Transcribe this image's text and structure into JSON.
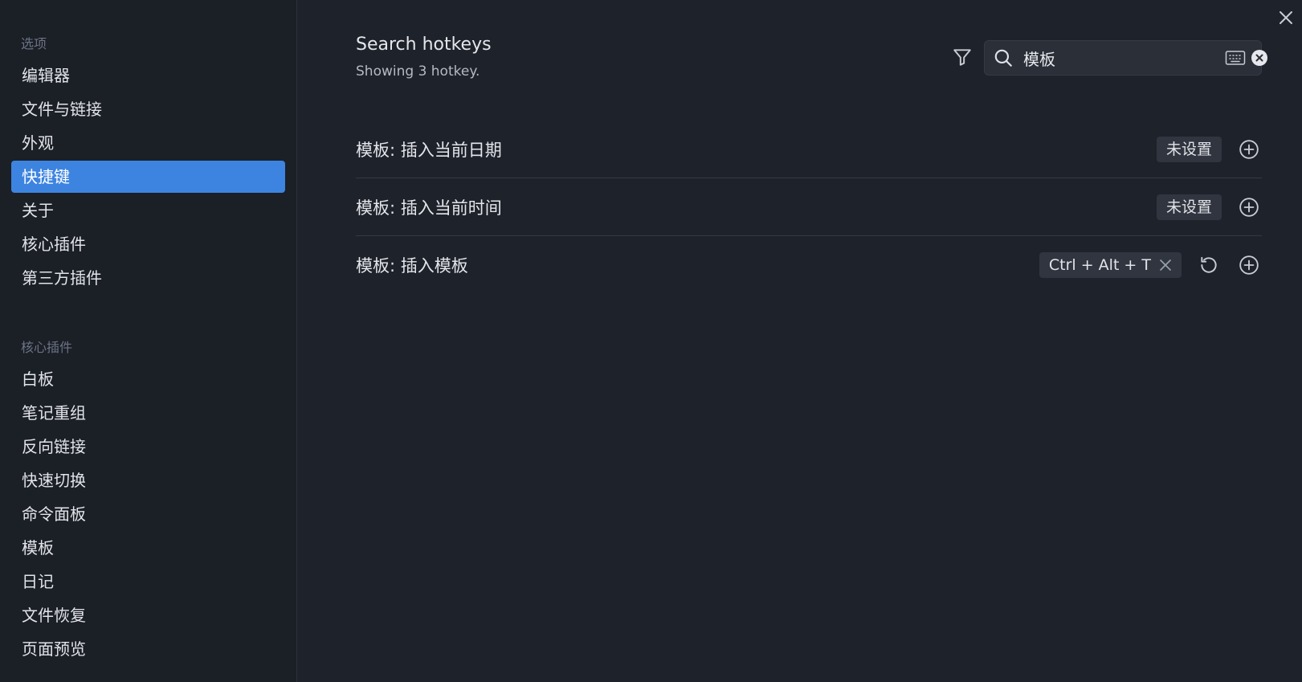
{
  "sidebar": {
    "section_options": "选项",
    "options_items": [
      {
        "label": "编辑器"
      },
      {
        "label": "文件与链接"
      },
      {
        "label": "外观"
      },
      {
        "label": "快捷键"
      },
      {
        "label": "关于"
      },
      {
        "label": "核心插件"
      },
      {
        "label": "第三方插件"
      }
    ],
    "active_item": "快捷键",
    "section_core_plugins": "核心插件",
    "core_plugin_items": [
      {
        "label": "白板"
      },
      {
        "label": "笔记重组"
      },
      {
        "label": "反向链接"
      },
      {
        "label": "快速切换"
      },
      {
        "label": "命令面板"
      },
      {
        "label": "模板"
      },
      {
        "label": "日记"
      },
      {
        "label": "文件恢复"
      },
      {
        "label": "页面预览"
      }
    ]
  },
  "header": {
    "title": "Search hotkeys",
    "subtitle": "Showing 3 hotkey."
  },
  "search": {
    "value": "模板",
    "placeholder": ""
  },
  "hotkeys": [
    {
      "label": "模板: 插入当前日期",
      "binding": "未设置"
    },
    {
      "label": "模板: 插入当前时间",
      "binding": "未设置"
    },
    {
      "label": "模板: 插入模板",
      "binding": "Ctrl + Alt + T"
    }
  ],
  "colors": {
    "accent": "#3d84e0",
    "background": "#1e222a",
    "sidebar": "#1b1f26"
  },
  "icons": {
    "close": "close-icon",
    "filter": "filter-icon",
    "search": "search-icon",
    "keyboard": "keyboard-icon",
    "clear": "clear-circle-icon",
    "add": "plus-circle-icon",
    "reset": "reset-icon"
  }
}
